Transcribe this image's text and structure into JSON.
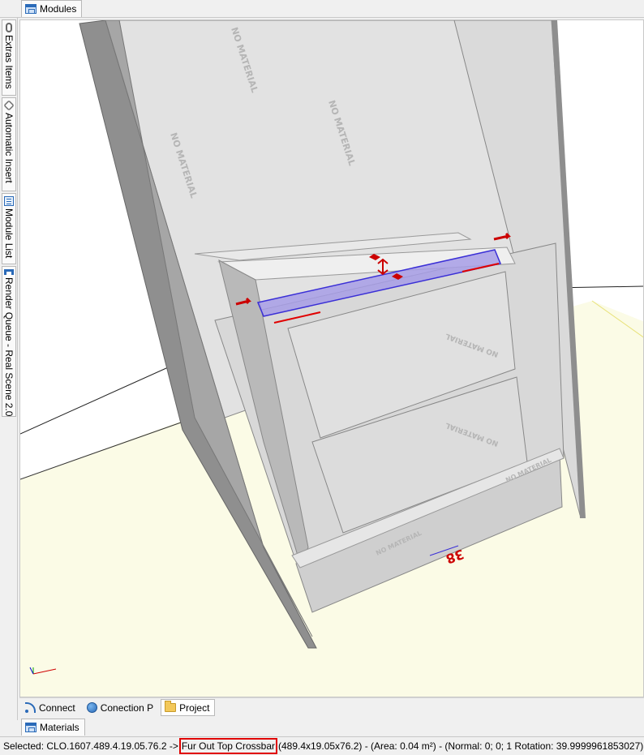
{
  "tabs": {
    "modules": "Modules",
    "materials": "Materials"
  },
  "side_tabs": [
    {
      "label": "Extras Items",
      "icon": "paperclip-icon"
    },
    {
      "label": "Automatic Insert",
      "icon": "chain-icon"
    },
    {
      "label": "Module List",
      "icon": "list-icon"
    },
    {
      "label": "Render Queue - Real Scene 2.0",
      "icon": "render-icon"
    }
  ],
  "bottom_tabs": [
    {
      "label": "Connect",
      "icon": "rss-icon",
      "active": false
    },
    {
      "label": "Conection P",
      "icon": "globe-icon",
      "active": false
    },
    {
      "label": "Project",
      "icon": "folder-icon",
      "active": true
    }
  ],
  "viewport": {
    "material_labels": [
      "NO MATERIAL",
      "NO MATERIAL",
      "NO MATERIAL",
      "NO MATERIAL",
      "NO MATERIAL",
      "NO MATERIAL",
      "NO MATERIAL"
    ],
    "dimension_label": "38",
    "colors": {
      "floor": "#fbfbe6",
      "panel_light": "#e3e3e3",
      "panel_mid": "#d4d4d4",
      "panel_dark": "#9a9a9a",
      "selection": "#8a7fd8",
      "handle": "#cc0000"
    }
  },
  "status": {
    "prefix": "Selected: CLO.1607.489.4.19.05.76.2 ->",
    "highlight": "Fur Out Top Crossbar",
    "suffix": "(489.4x19.05x76.2) - (Area: 0.04 m²) - (Normal: 0; 0; 1 Rotation: 39.9999961853027)"
  }
}
